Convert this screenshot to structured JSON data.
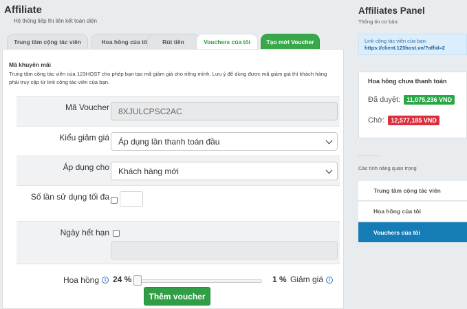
{
  "header": {
    "title": "Affiliate",
    "subtitle": "Hệ thống tiếp thị liên kết toàn diện"
  },
  "tabs": [
    {
      "label": "Trung tâm cộng tác viên",
      "active": false
    },
    {
      "label": "Hoa hồng của tôi",
      "active": false
    },
    {
      "label": "Rút tiền",
      "active": false
    },
    {
      "label": "Vouchers của tôi",
      "active": true
    },
    {
      "label": "Tạo mới Voucher",
      "active": false
    }
  ],
  "panel": {
    "title": "Mã khuyến mãi",
    "description": "Trung tâm cộng tác viên của 123HOST cho phép bạn tạo mã giảm giá cho riêng mình. Lưu ý để dùng được mã giảm giá thì khách hàng phải truy cập từ link cộng tác viên của bạn."
  },
  "form": {
    "voucher_code_label": "Mã Voucher",
    "voucher_code_value": "8XJULCPSC2AC",
    "discount_type_label": "Kiểu giảm giá",
    "discount_type_value": "Áp dụng lần thanh toán đầu",
    "apply_to_label": "Áp dụng cho",
    "apply_to_value": "Khách hàng mới",
    "usage_limit_label": "Số lần sử dụng tối đa",
    "expiry_label": "Ngày hết hạn",
    "commission_label": "Hoa hồng",
    "commission_value": "24 %",
    "discount_value": "1 %",
    "discount_label": "Giảm giá",
    "slider_fraction": 0.0,
    "submit_label": "Thêm voucher"
  },
  "sidebar": {
    "title": "Affiliates Panel",
    "subtitle": "Thông tin cơ bản:",
    "link_label": "Link cộng tác viên của bạn:",
    "link_url": "https://client.123host.vn/?affid=2",
    "commission_title": "Hoa hồng chưa thanh toán",
    "approved_label": "Đã duyệt:",
    "approved_value": "11,075,236 VND",
    "pending_label": "Chờ:",
    "pending_value": "12,577,185 VND",
    "features_label": "Các tính năng quan trọng",
    "menu": [
      {
        "label": "Trung tâm cộng tác viên",
        "active": false
      },
      {
        "label": "Hoa hồng của tôi",
        "active": false
      },
      {
        "label": "Vouchers của tôi",
        "active": true
      }
    ]
  },
  "colors": {
    "green": "#2f9e44",
    "red": "#dc2e3c",
    "blue": "#167cb5"
  }
}
